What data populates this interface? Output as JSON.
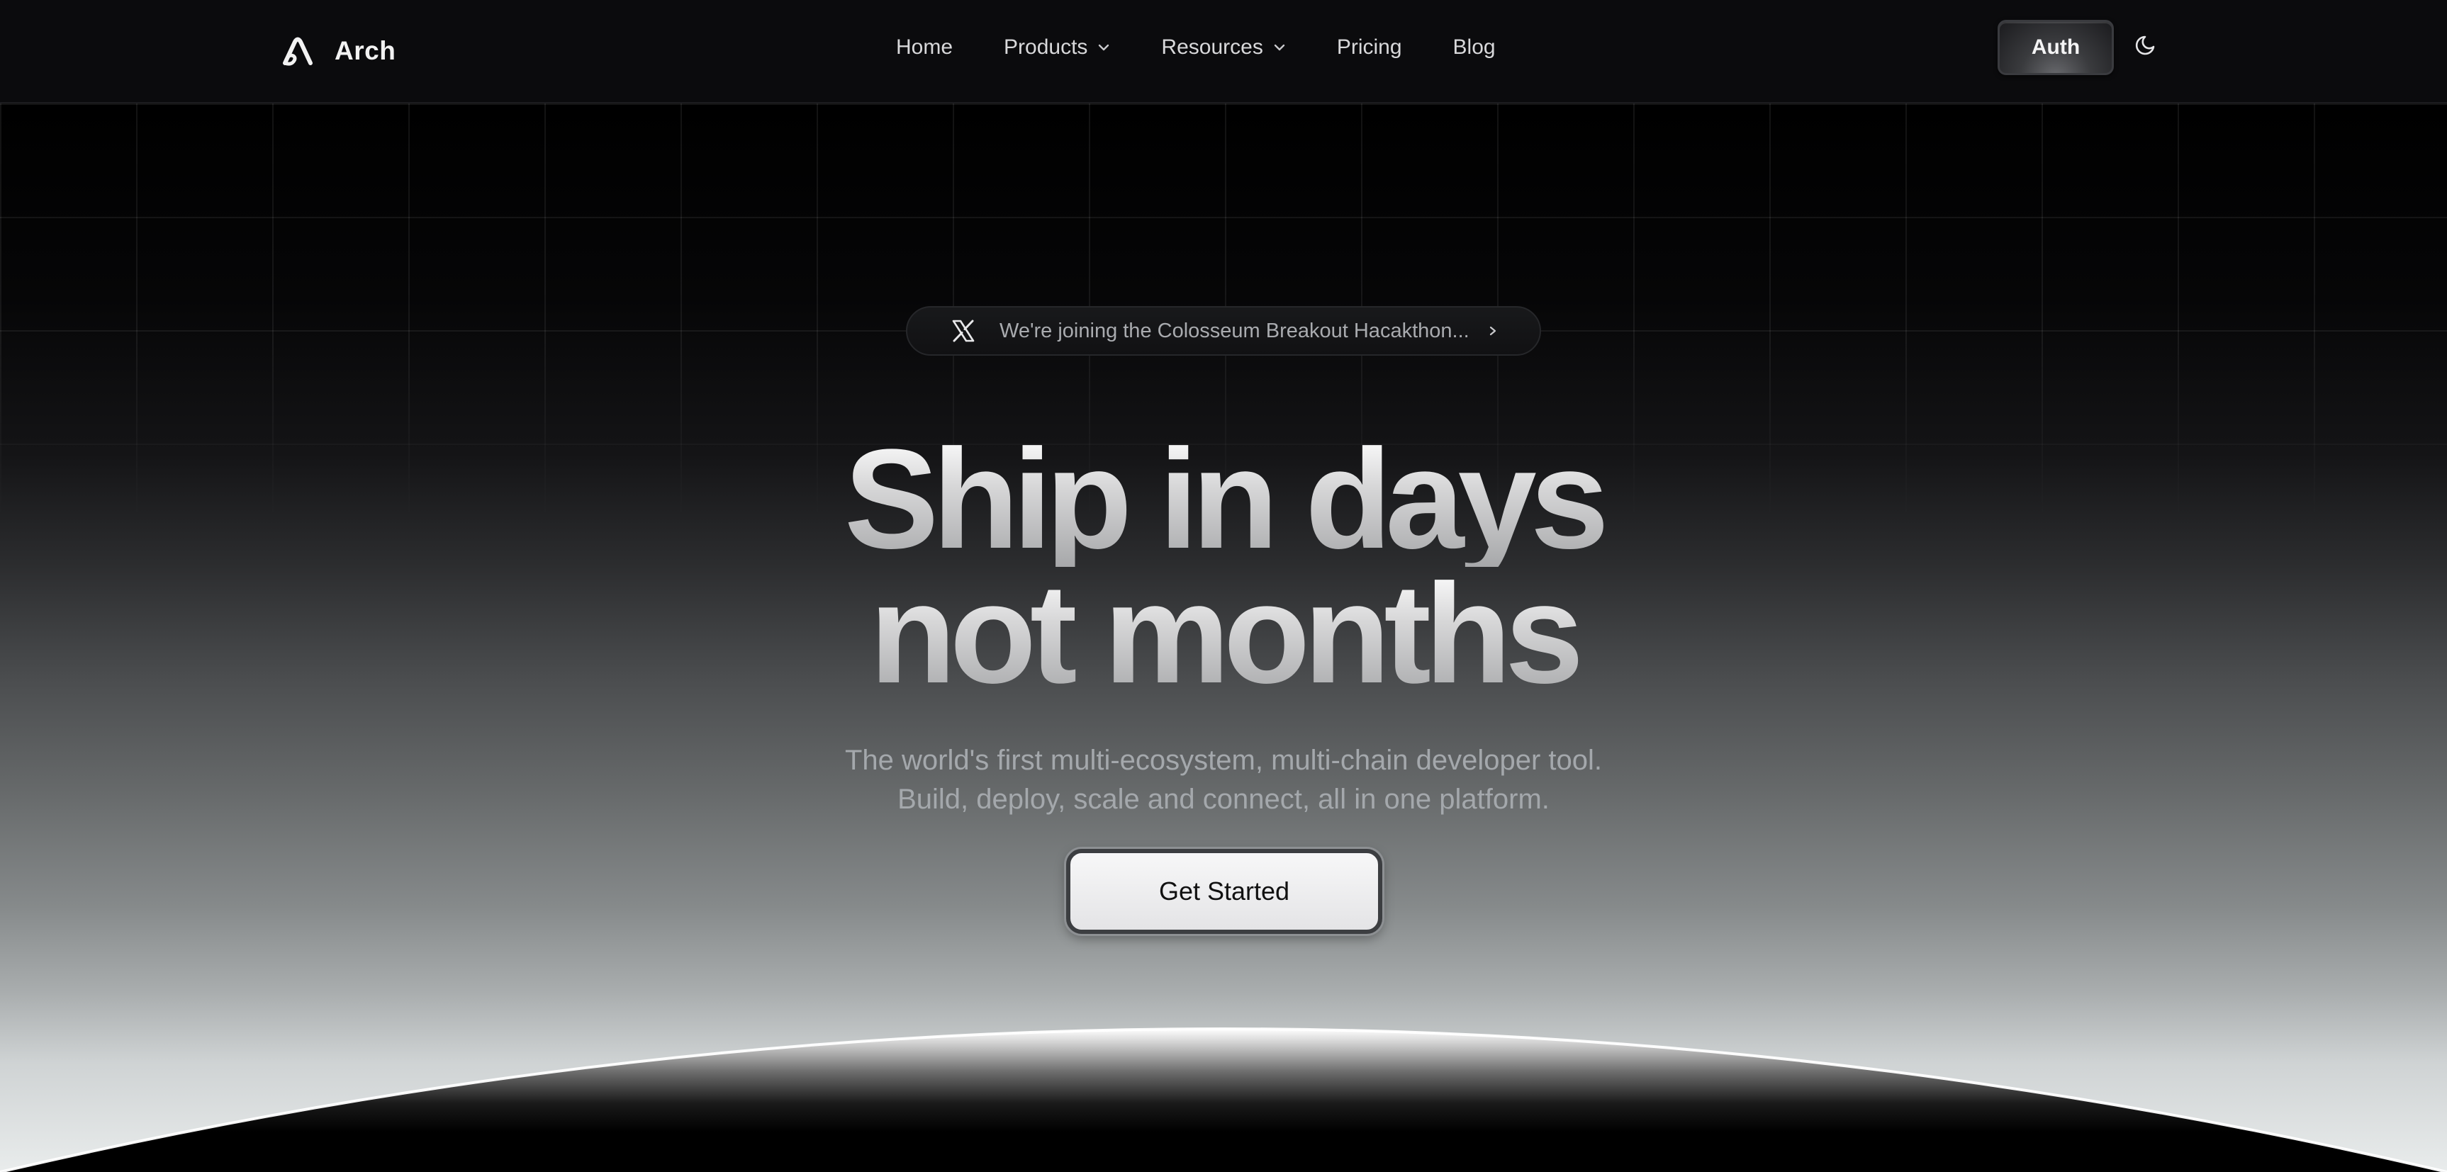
{
  "nav": {
    "brand": "Arch",
    "links": [
      {
        "label": "Home",
        "dropdown": false
      },
      {
        "label": "Products",
        "dropdown": true
      },
      {
        "label": "Resources",
        "dropdown": true
      },
      {
        "label": "Pricing",
        "dropdown": false
      },
      {
        "label": "Blog",
        "dropdown": false
      }
    ],
    "auth_label": "Auth",
    "theme_icon": "moon-icon"
  },
  "hero": {
    "announcement": {
      "icon": "x-logo-icon",
      "text": "We're joining the Colosseum Breakout Hacakthon...",
      "arrow_icon": "chevron-right-icon"
    },
    "headline_line1": "Ship in days",
    "headline_line2": "not months",
    "subtitle_line1": "The world's first multi-ecosystem, multi-chain developer tool.",
    "subtitle_line2": "Build, deploy, scale and connect, all in one platform.",
    "cta_label": "Get Started"
  },
  "colors": {
    "nav_bg": "#0b0b0d",
    "accent_light": "#f4f4f5",
    "subtitle": "#a4a8ac"
  }
}
